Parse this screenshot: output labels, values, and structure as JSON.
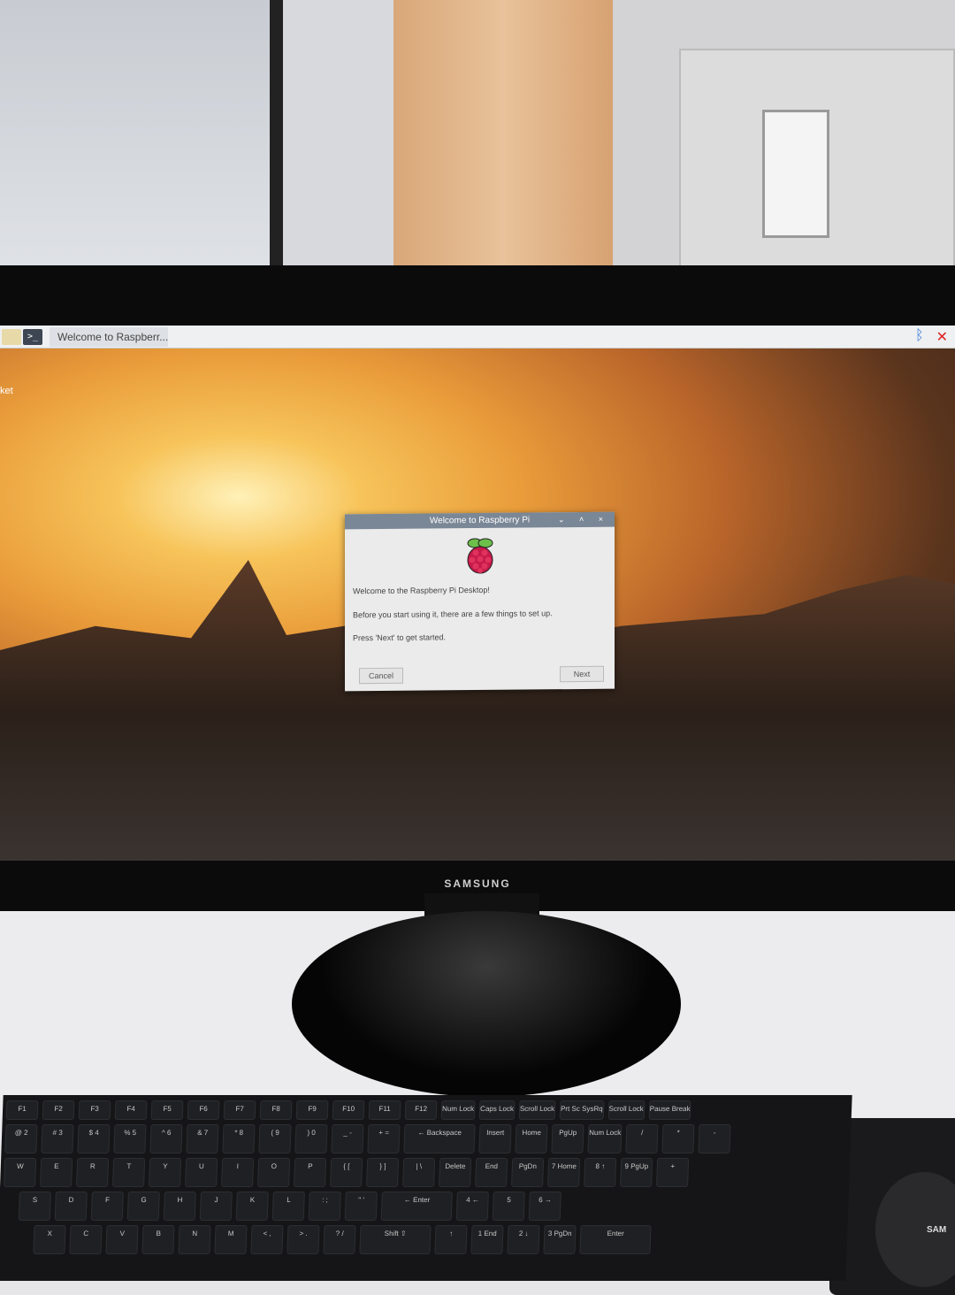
{
  "taskbar": {
    "task_label": "Welcome to Raspberr...",
    "terminal_glyph": ">_",
    "tray": {
      "bluetooth": "bluetooth-icon",
      "network": "network-disconnected-icon"
    }
  },
  "desktop": {
    "icon_label": "ket"
  },
  "dialog": {
    "title": "Welcome to Raspberry Pi",
    "controls": "⌄ ˄ ×",
    "line1": "Welcome to the Raspberry Pi Desktop!",
    "line2": "Before you start using it, there are a few things to set up.",
    "line3": "Press 'Next' to get started.",
    "cancel": "Cancel",
    "next": "Next"
  },
  "monitor": {
    "brand": "SAMSUNG"
  },
  "mouse": {
    "brand": "SAM"
  },
  "keyboard": {
    "rows": [
      [
        "F1",
        "F2",
        "F3",
        "F4",
        "F5",
        "F6",
        "F7",
        "F8",
        "F9",
        "F10",
        "F11",
        "F12",
        "Num Lock",
        "Caps Lock",
        "Scroll Lock",
        "Prt Sc SysRq",
        "Scroll Lock",
        "Pause Break"
      ],
      [
        "@ 2",
        "# 3",
        "$ 4",
        "% 5",
        "^ 6",
        "& 7",
        "* 8",
        "( 9",
        ") 0",
        "_ -",
        "+ =",
        "← Backspace",
        "Insert",
        "Home",
        "PgUp",
        "Num Lock",
        "/",
        "*",
        "-"
      ],
      [
        "W",
        "E",
        "R",
        "T",
        "Y",
        "U",
        "I",
        "O",
        "P",
        "{ [",
        "} ]",
        "| \\",
        "Delete",
        "End",
        "PgDn",
        "7 Home",
        "8 ↑",
        "9 PgUp",
        "+"
      ],
      [
        "S",
        "D",
        "F",
        "G",
        "H",
        "J",
        "K",
        "L",
        ": ;",
        "\" '",
        "← Enter",
        "4 ←",
        "5",
        "6 →"
      ],
      [
        "X",
        "C",
        "V",
        "B",
        "N",
        "M",
        "< ,",
        "> .",
        "? /",
        "Shift ⇧",
        "↑",
        "1 End",
        "2 ↓",
        "3 PgDn",
        "Enter"
      ]
    ]
  }
}
